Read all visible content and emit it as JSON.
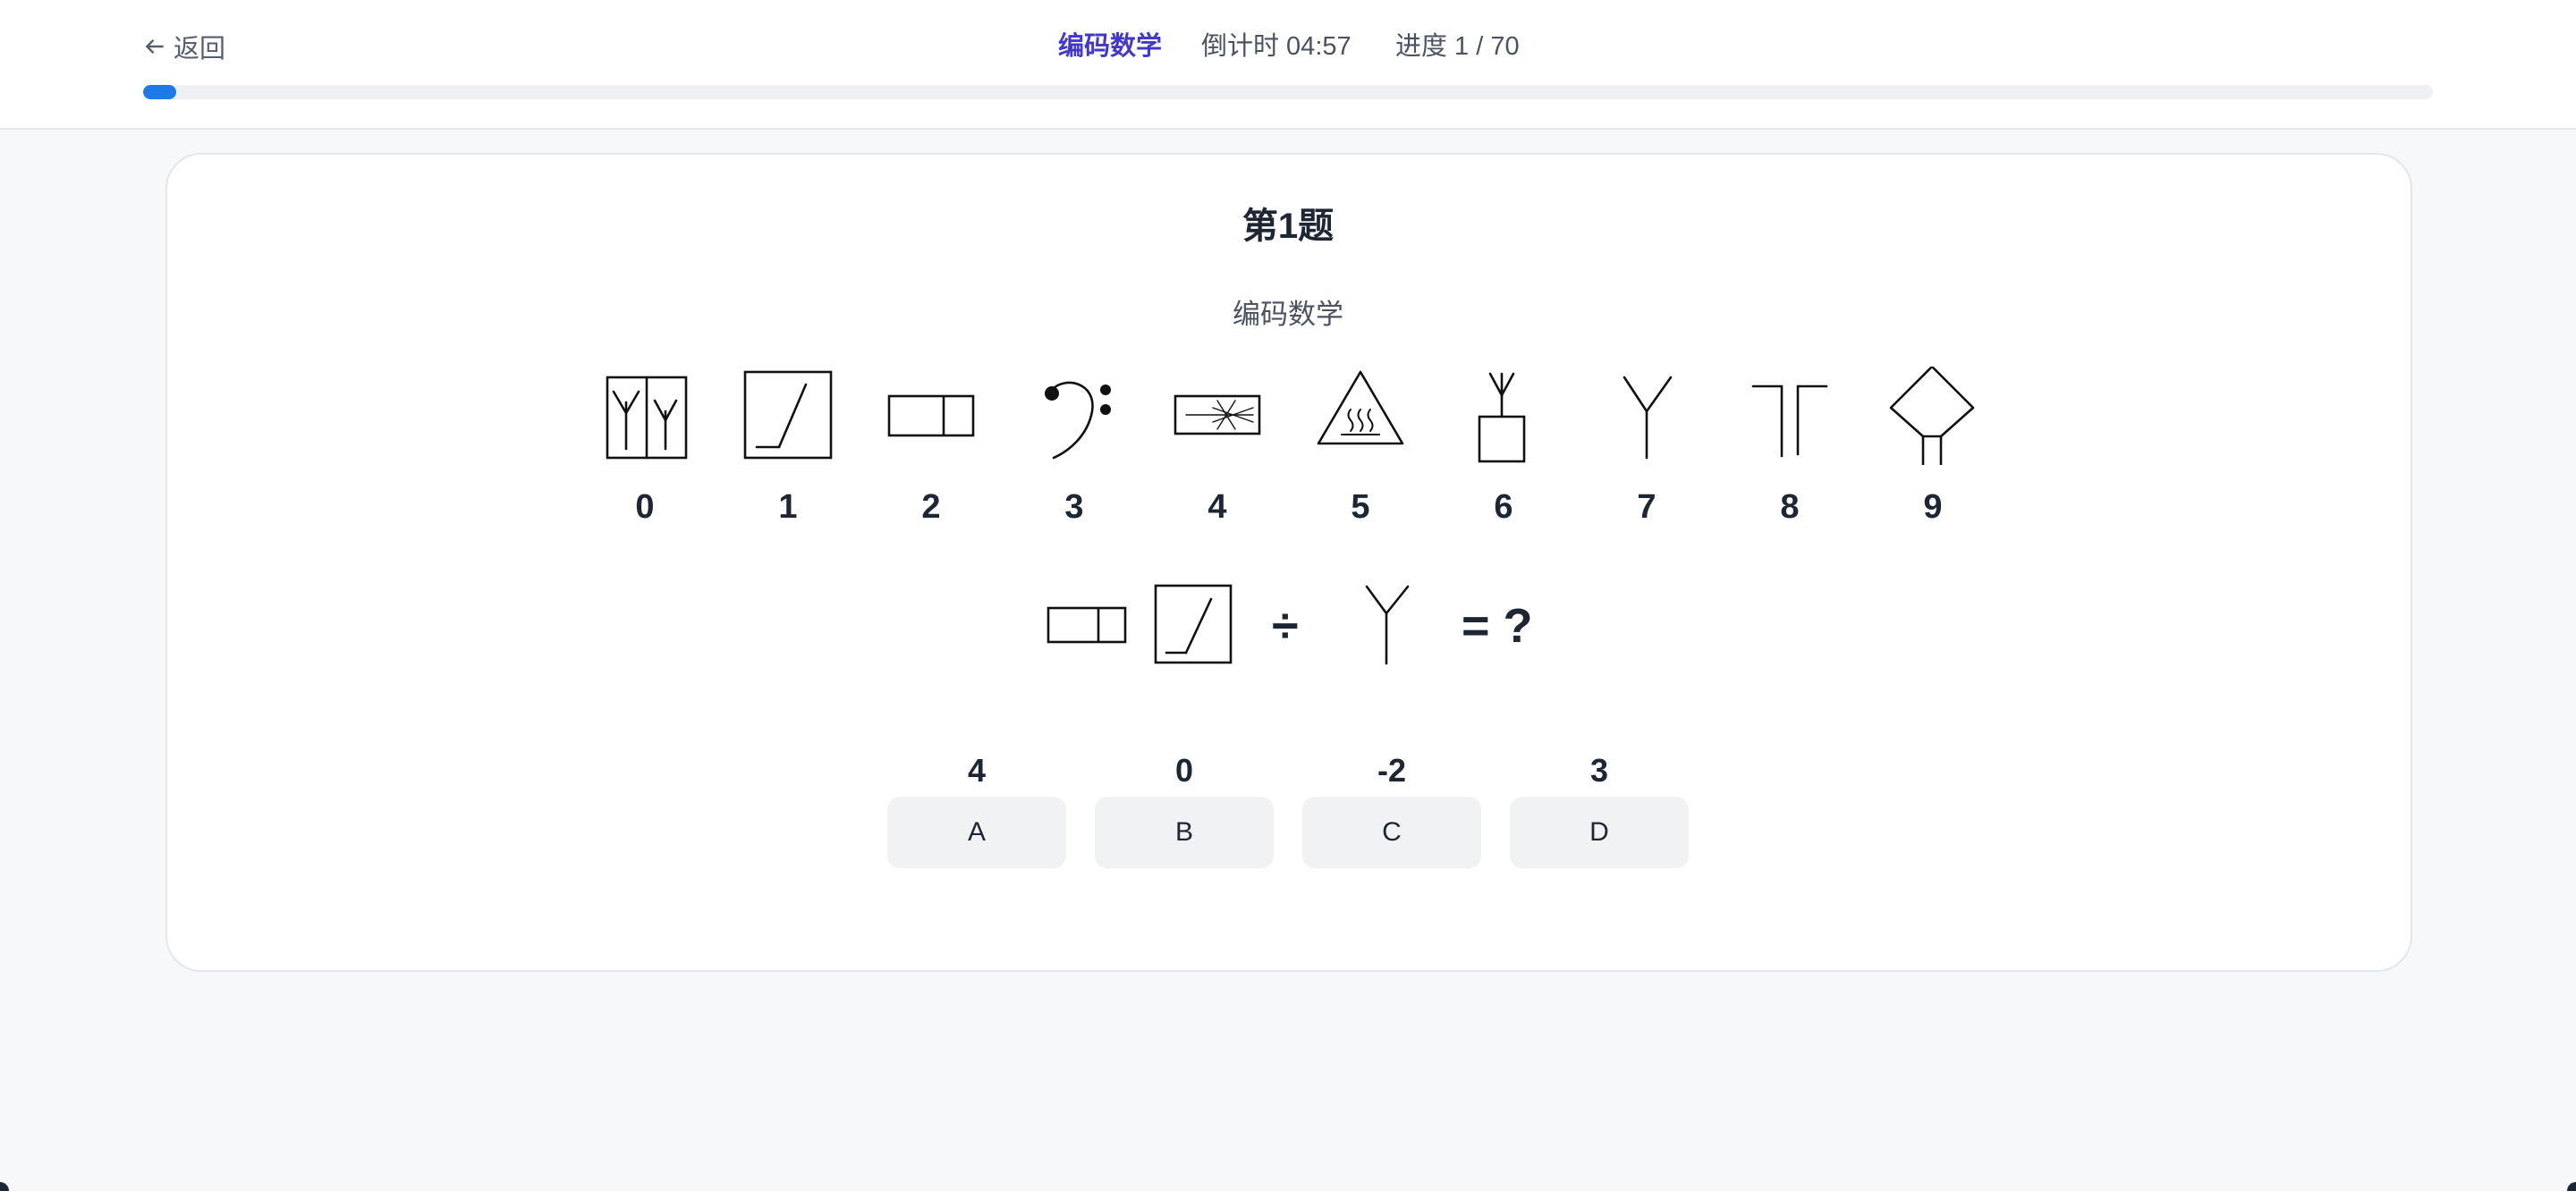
{
  "header": {
    "back_label": "返回",
    "mode_label": "编码数学",
    "timer_text": "倒计时 04:57",
    "progress_text": "进度 1 / 70",
    "progress_fraction": 0.0143,
    "accent_color": "#4338ca",
    "bar_color": "#1d7ae6"
  },
  "question": {
    "title": "第1题",
    "subtitle": "编码数学",
    "legend": [
      {
        "icon": "double-fork-box-icon",
        "digit": "0"
      },
      {
        "icon": "slash-box-icon",
        "digit": "1"
      },
      {
        "icon": "split-rectangle-icon",
        "digit": "2"
      },
      {
        "icon": "bass-clef-icon",
        "digit": "3"
      },
      {
        "icon": "starburst-rectangle-icon",
        "digit": "4"
      },
      {
        "icon": "hot-surface-triangle-icon",
        "digit": "5"
      },
      {
        "icon": "fork-on-box-icon",
        "digit": "6"
      },
      {
        "icon": "fork-icon",
        "digit": "7"
      },
      {
        "icon": "double-post-icon",
        "digit": "8"
      },
      {
        "icon": "diamond-on-posts-icon",
        "digit": "9"
      }
    ],
    "equation": {
      "operand_icons": [
        "split-rectangle-icon",
        "slash-box-icon"
      ],
      "operator": "÷",
      "divisor_icon": "fork-icon",
      "result": "= ?"
    },
    "options": [
      {
        "letter": "A",
        "value": "4"
      },
      {
        "letter": "B",
        "value": "0"
      },
      {
        "letter": "C",
        "value": "-2"
      },
      {
        "letter": "D",
        "value": "3"
      }
    ]
  }
}
